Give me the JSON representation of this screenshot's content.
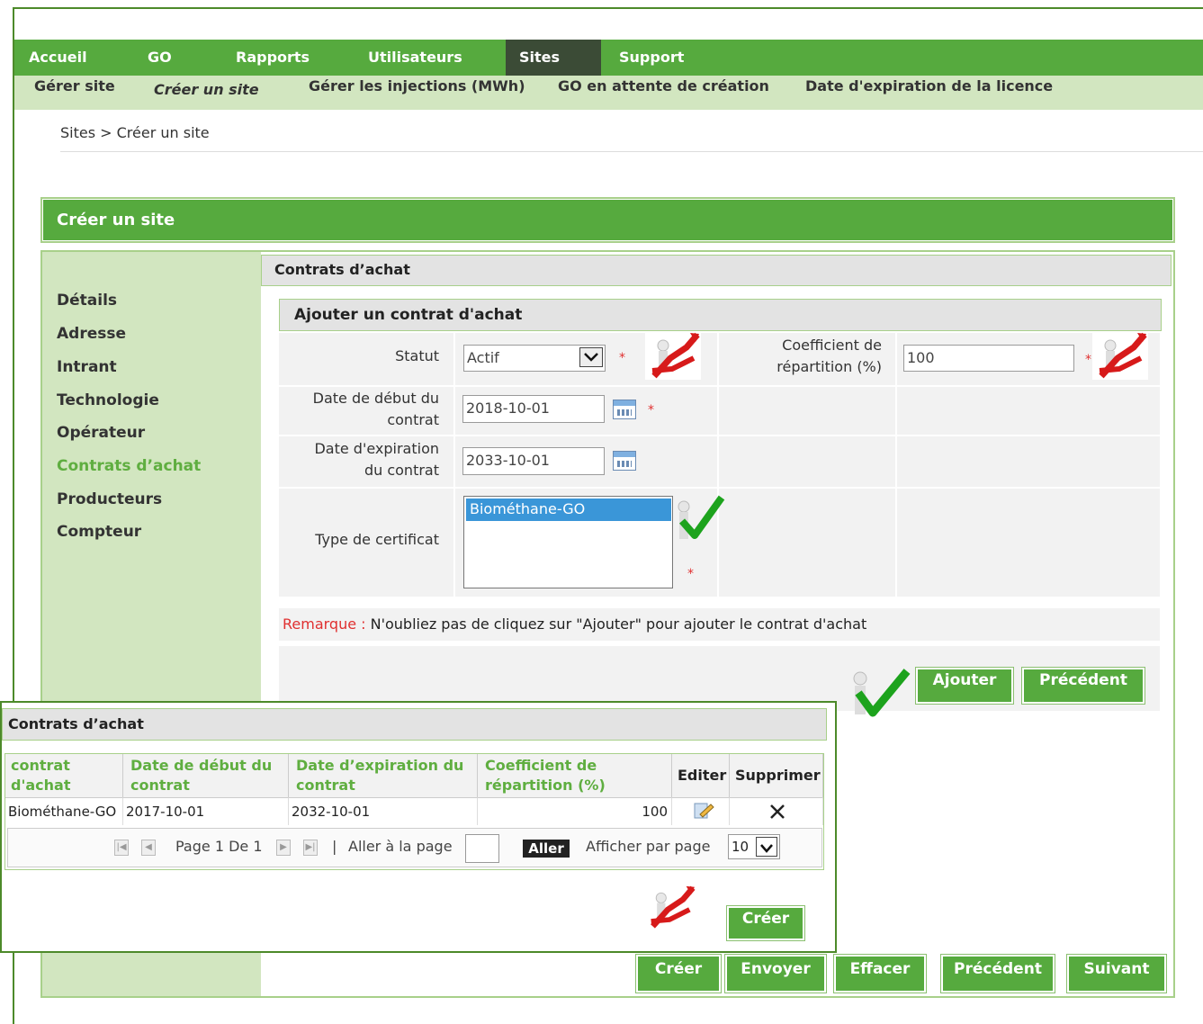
{
  "nav": {
    "items": [
      "Accueil",
      "GO",
      "Rapports",
      "Utilisateurs",
      "Sites",
      "Support"
    ],
    "active": "Sites"
  },
  "subnav": {
    "items": [
      "Gérer site",
      "Créer un site",
      "Gérer les injections (MWh)",
      "GO en attente de création",
      "Date d'expiration de la licence"
    ]
  },
  "breadcrumb": "Sites > Créer un site",
  "panel_title": "Créer un site",
  "sidebar": {
    "items": [
      "Détails",
      "Adresse",
      "Intrant",
      "Technologie",
      "Opérateur",
      "Contrats d’achat",
      "Producteurs",
      "Compteur"
    ],
    "active": "Contrats d’achat"
  },
  "section_title": "Contrats d’achat",
  "form": {
    "title": "Ajouter un contrat d'achat",
    "statut_label": "Statut",
    "statut_value": "Actif",
    "coef_label_1": "Coefficient de",
    "coef_label_2": "répartition (%)",
    "coef_value": "100",
    "start_label_1": "Date de début du",
    "start_label_2": "contrat",
    "start_value": "2018-10-01",
    "end_label_1": "Date d'expiration",
    "end_label_2": "du contrat",
    "end_value": "2033-10-01",
    "cert_label": "Type de certificat",
    "cert_options": [
      "Biométhane-GO"
    ],
    "required_mark": "*"
  },
  "remark": {
    "label": "Remarque :",
    "text": " N'oubliez pas de cliquez sur \"Ajouter\" pour ajouter le contrat d'achat"
  },
  "buttons": {
    "ajouter": "Ajouter",
    "precedent": "Précédent",
    "creer": "Créer",
    "envoyer": "Envoyer",
    "effacer": "Effacer",
    "suivant": "Suivant"
  },
  "overlay": {
    "title": "Contrats d’achat",
    "columns": [
      "contrat d'achat",
      "Date de début du contrat",
      "Date d’expiration du contrat",
      "Coefficient de répartition (%)",
      "Editer",
      "Supprimer"
    ],
    "rows": [
      {
        "type": "Biométhane-GO",
        "start": "2017-10-01",
        "end": "2032-10-01",
        "coef": "100"
      }
    ],
    "pager": {
      "page_text": "Page 1 De 1",
      "separator": "|",
      "goto_label": "Aller à la page",
      "go_button": "Aller",
      "per_page_label": "Afficher par page",
      "per_page_value": "10"
    },
    "create_button": "Créer"
  },
  "icons": {
    "calendar": "calendar-icon",
    "edit": "edit-icon",
    "delete": "delete-x-icon",
    "dropdown": "chevron-down-icon",
    "first": "first-page-icon",
    "prev": "prev-page-icon",
    "next": "next-page-icon",
    "last": "last-page-icon"
  },
  "colors": {
    "brand_green": "#56aa3e",
    "light_green": "#d2e6c0",
    "active_nav": "#3b4b36",
    "required_red": "#e03030",
    "selection_blue": "#3a96d8"
  }
}
